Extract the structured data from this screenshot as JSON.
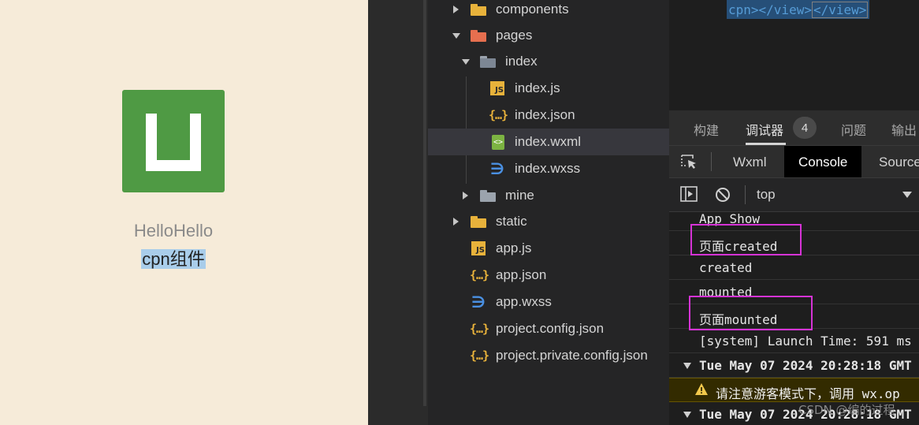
{
  "preview": {
    "text_line1": "HelloHello",
    "text_line2": "cpn组件",
    "logo_icon": "uni-app-logo-icon",
    "colors": {
      "background": "#f6ebd9",
      "logo": "#4f9a44",
      "selection": "#a9cdea"
    }
  },
  "file_tree": {
    "items": [
      {
        "label": "components",
        "type": "folder",
        "icon": "components-folder-icon",
        "expanded": false
      },
      {
        "label": "pages",
        "type": "folder",
        "icon": "pages-folder-icon",
        "expanded": true
      },
      {
        "label": "index",
        "type": "folder",
        "icon": "folder-open-icon",
        "expanded": true
      },
      {
        "label": "index.js",
        "type": "file",
        "icon": "js-file-icon"
      },
      {
        "label": "index.json",
        "type": "file",
        "icon": "json-file-icon"
      },
      {
        "label": "index.wxml",
        "type": "file",
        "icon": "wxml-file-icon",
        "selected": true
      },
      {
        "label": "index.wxss",
        "type": "file",
        "icon": "wxss-file-icon"
      },
      {
        "label": "mine",
        "type": "folder",
        "icon": "folder-icon",
        "expanded": false
      },
      {
        "label": "static",
        "type": "folder",
        "icon": "static-folder-icon",
        "expanded": false
      },
      {
        "label": "app.js",
        "type": "file",
        "icon": "js-file-icon"
      },
      {
        "label": "app.json",
        "type": "file",
        "icon": "json-file-icon"
      },
      {
        "label": "app.wxss",
        "type": "file",
        "icon": "wxss-file-icon"
      },
      {
        "label": "project.config.json",
        "type": "file",
        "icon": "json-file-icon"
      },
      {
        "label": "project.private.config.json",
        "type": "file",
        "icon": "json-file-icon"
      }
    ]
  },
  "editor": {
    "code_part1": "cpn></view>",
    "code_part2": "</view>"
  },
  "debugger": {
    "top_tabs": [
      "构建",
      "调试器",
      "问题",
      "输出"
    ],
    "active_top_tab": "调试器",
    "badge": "4",
    "panel_tabs": [
      "Wxml",
      "Console",
      "Source"
    ],
    "active_panel_tab": "Console",
    "context": "top",
    "console_lines": [
      {
        "text": "App Show",
        "kind": "log"
      },
      {
        "text": "页面created",
        "kind": "log",
        "highlight": true
      },
      {
        "text": "created",
        "kind": "log"
      },
      {
        "text": "mounted",
        "kind": "log"
      },
      {
        "text": "页面mounted",
        "kind": "log",
        "highlight": true
      },
      {
        "text": "[system] Launch Time: 591 ms",
        "kind": "log"
      },
      {
        "text": "Tue May 07 2024 20:28:18 GMT",
        "kind": "group"
      },
      {
        "text": "请注意游客模式下，调用 wx.op",
        "kind": "warning"
      },
      {
        "text": "Tue May 07 2024 20:28:18 GMT",
        "kind": "group"
      }
    ],
    "colors": {
      "highlight_border": "#d633d6",
      "warning_bg": "#332b00"
    }
  },
  "watermark": "CSDN @编的过程"
}
